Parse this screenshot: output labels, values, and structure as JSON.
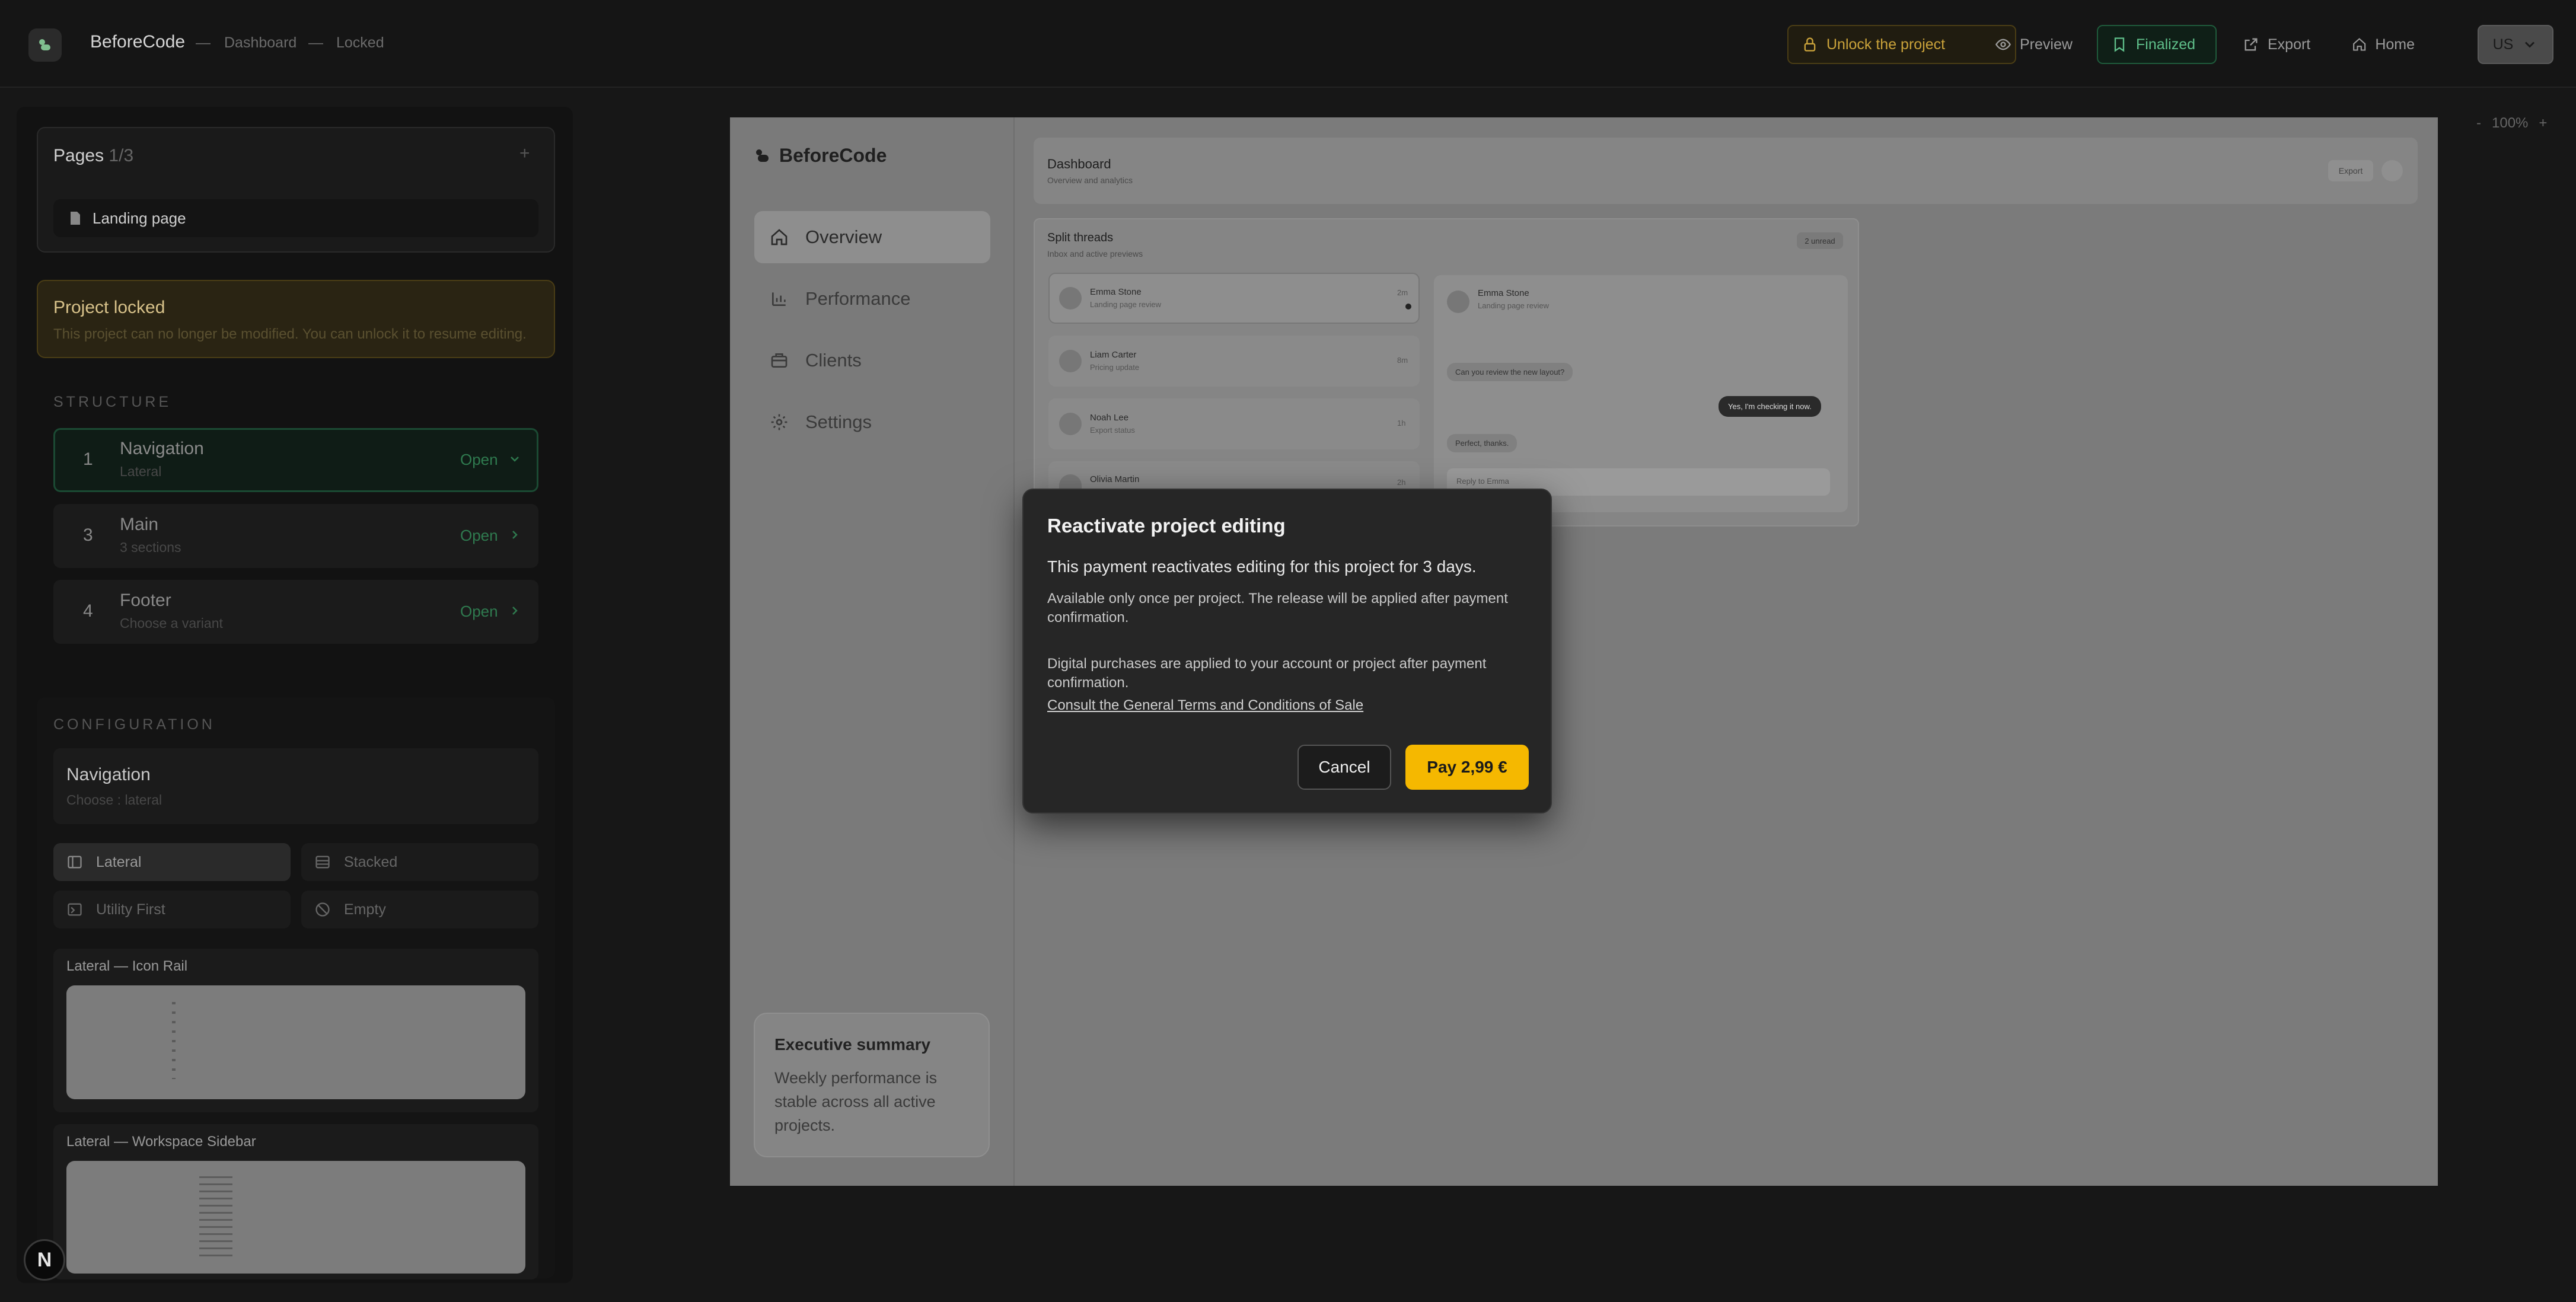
{
  "header": {
    "app_name": "BeforeCode",
    "sep": "—",
    "crumbs": [
      "Dashboard",
      "Locked"
    ],
    "buttons": {
      "unlock": "Unlock the project",
      "preview": "Preview",
      "finalized": "Finalized",
      "export": "Export",
      "home": "Home",
      "lang": "US"
    }
  },
  "sidebar": {
    "pages_title": "Pages",
    "pages_count": "1/3",
    "add": "+",
    "page_item": "Landing page",
    "locked_title": "Project locked",
    "locked_text": "This project can no longer be modified. You can unlock it to resume editing.",
    "structure_label": "STRUCTURE",
    "structure": [
      {
        "num": "1",
        "title": "Navigation",
        "sub": "Lateral",
        "action": "Open"
      },
      {
        "num": "3",
        "title": "Main",
        "sub": "3 sections",
        "action": "Open"
      },
      {
        "num": "4",
        "title": "Footer",
        "sub": "Choose a variant",
        "action": "Open"
      }
    ],
    "config_label": "CONFIGURATION",
    "config_title": "Navigation",
    "config_sub": "Choose : lateral",
    "options": [
      "Lateral",
      "Stacked",
      "Utility First",
      "Empty"
    ],
    "variant1": "Lateral — Icon Rail",
    "variant2": "Lateral — Workspace Sidebar"
  },
  "zoom": {
    "minus": "-",
    "value": "100%",
    "plus": "+"
  },
  "preview": {
    "brand": "BeforeCode",
    "nav": [
      "Overview",
      "Performance",
      "Clients",
      "Settings"
    ],
    "summary_title": "Executive summary",
    "summary_text": "Weekly performance is stable across all active projects.",
    "dash_title": "Dashboard",
    "dash_sub": "Overview and analytics",
    "dash_export": "Export",
    "threads_title": "Split threads",
    "threads_sub": "Inbox and active previews",
    "threads_badge": "2 unread",
    "threads": [
      {
        "name": "Emma Stone",
        "sub": "Landing page review",
        "time": "2m"
      },
      {
        "name": "Liam Carter",
        "sub": "Pricing update",
        "time": "8m"
      },
      {
        "name": "Noah Lee",
        "sub": "Export status",
        "time": "1h"
      },
      {
        "name": "Olivia Martin",
        "sub": "",
        "time": "2h"
      }
    ],
    "chat_name": "Emma Stone",
    "chat_sub": "Landing page review",
    "msg1": "Can you review the new layout?",
    "msg2": "Yes, I'm checking it now.",
    "msg3": "Perfect, thanks.",
    "reply_placeholder": "Reply to Emma"
  },
  "modal": {
    "title": "Reactivate project editing",
    "lead": "This payment reactivates editing for this project for 3 days.",
    "p1": "Available only once per project. The release will be applied after payment confirmation.",
    "p2": "Digital purchases are applied to your account or project after payment confirmation.",
    "link": "Consult the General Terms and Conditions of Sale",
    "cancel": "Cancel",
    "pay": "Pay 2,99 €"
  },
  "fab": "N",
  "colors": {
    "accent": "#f5b800",
    "green": "#1f6b45",
    "locked": "#2a2413"
  }
}
